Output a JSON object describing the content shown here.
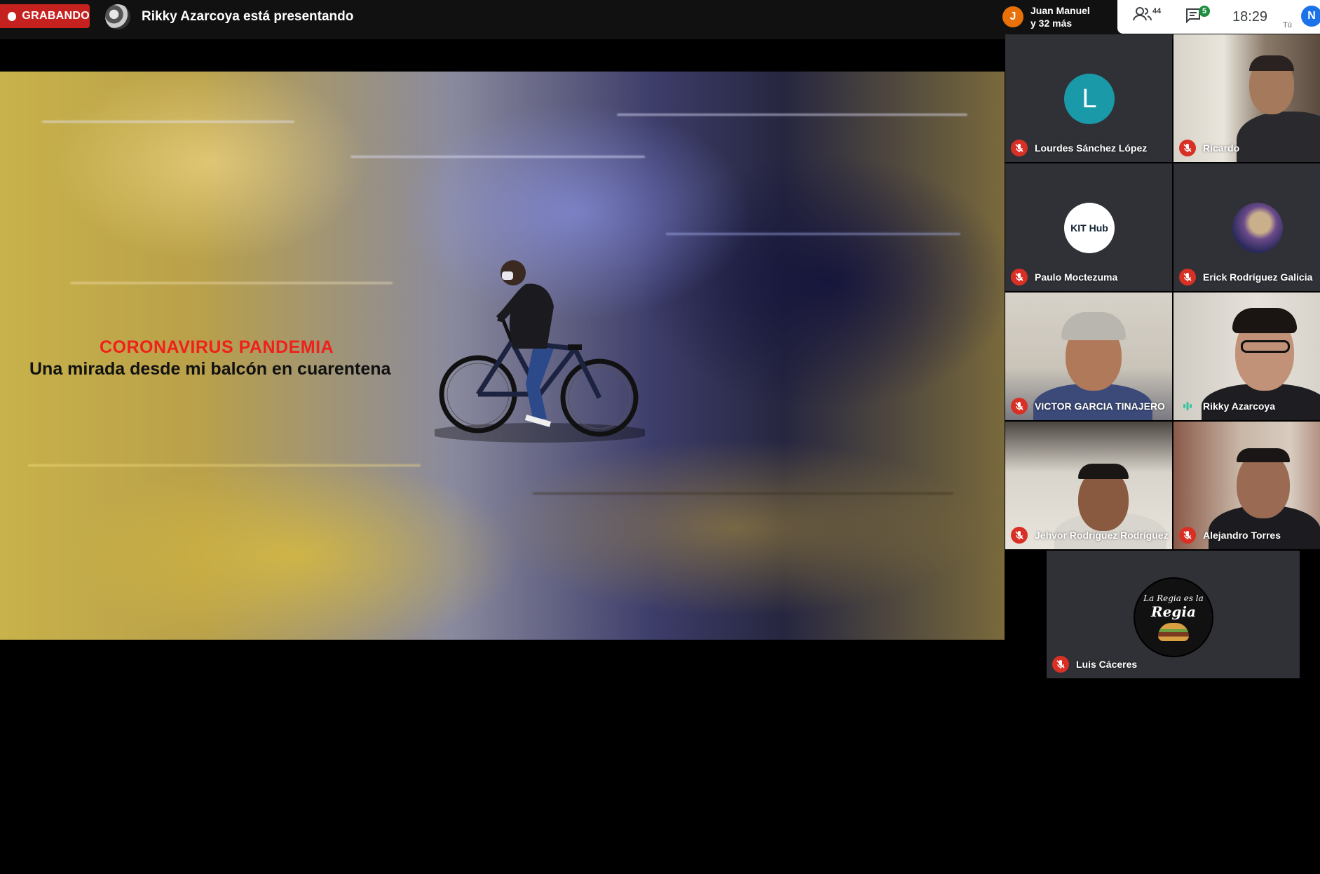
{
  "recording": {
    "label": "GRABANDO"
  },
  "presenter": {
    "text": "Rikky Azarcoya está presentando"
  },
  "others": {
    "initial": "J",
    "line1": "Juan Manuel",
    "line2": "y 32 más"
  },
  "toolbar": {
    "people_icon": "people-icon",
    "people_count": "44",
    "chat_icon": "chat-icon",
    "chat_count": "5",
    "clock": "18:29",
    "self_label": "Tú",
    "self_initial": "N"
  },
  "slide": {
    "title": "CORONAVIRUS PANDEMIA",
    "subtitle": "Una mirada desde mi balcón en cuarentena"
  },
  "participants": [
    {
      "name": "Lourdes Sánchez López",
      "avatar_initial": "L",
      "avatar_color": "#1a9aa8",
      "muted": true
    },
    {
      "name": "Ricardo",
      "muted": true
    },
    {
      "name": "Paulo Moctezuma",
      "avatar_logo": "KIT Hub",
      "muted": true
    },
    {
      "name": "Erick Rodríguez Galicia",
      "muted": true
    },
    {
      "name": "VICTOR GARCIA TINAJERO",
      "muted": true
    },
    {
      "name": "Rikky Azarcoya",
      "muted": false
    },
    {
      "name": "Jehvor Rodríguez Rodríguez",
      "muted": true
    },
    {
      "name": "Alejandro Torres",
      "muted": true
    },
    {
      "name": "Luis Cáceres",
      "avatar_logo_lines": [
        "La Regia es la",
        "Regia"
      ],
      "muted": true
    }
  ],
  "colors": {
    "recording": "#c5221f",
    "muted": "#d93025",
    "speaking": "#1e8e3e",
    "self": "#1a73e8"
  }
}
